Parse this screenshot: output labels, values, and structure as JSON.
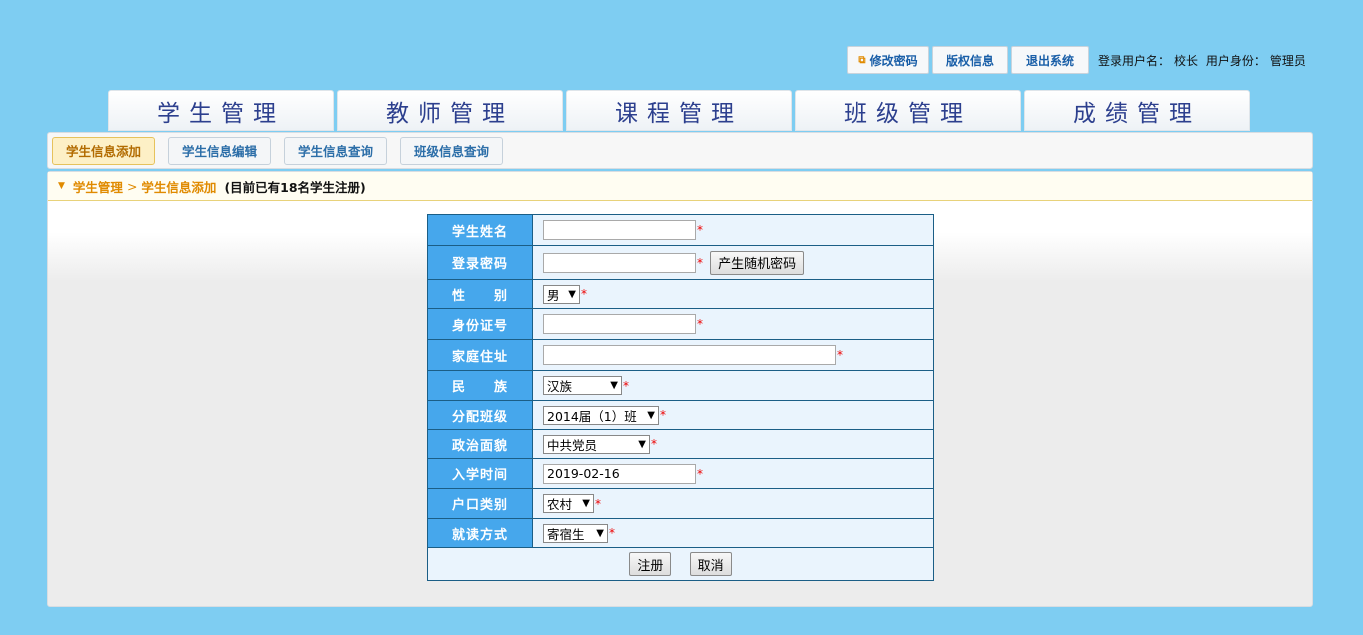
{
  "topbar": {
    "change_password": "修改密码",
    "copyright": "版权信息",
    "logout": "退出系统",
    "username_label": "登录用户名：",
    "username": "校长",
    "role_label": "用户身份：",
    "role": "管理员"
  },
  "nav": {
    "tabs": [
      "学生管理",
      "教师管理",
      "课程管理",
      "班级管理",
      "成绩管理"
    ]
  },
  "subnav": {
    "tabs": [
      "学生信息添加",
      "学生信息编辑",
      "学生信息查询",
      "班级信息查询"
    ],
    "active_index": 0
  },
  "breadcrumb": {
    "section": "学生管理",
    "separator": ">",
    "page": "学生信息添加",
    "note": "(目前已有18名学生注册)"
  },
  "form": {
    "fields": [
      {
        "label": "学生姓名",
        "type": "text",
        "value": "",
        "required": true
      },
      {
        "label": "登录密码",
        "type": "text",
        "value": "",
        "required": true,
        "button": "产生随机密码"
      },
      {
        "label": "性　　别",
        "type": "select",
        "value": "男",
        "required": true
      },
      {
        "label": "身份证号",
        "type": "text",
        "value": "",
        "required": true
      },
      {
        "label": "家庭住址",
        "type": "text",
        "value": "",
        "required": true
      },
      {
        "label": "民　　族",
        "type": "select",
        "value": "汉族",
        "required": true
      },
      {
        "label": "分配班级",
        "type": "select",
        "value": "2014届（1）班",
        "required": true
      },
      {
        "label": "政治面貌",
        "type": "select",
        "value": "中共党员",
        "required": true
      },
      {
        "label": "入学时间",
        "type": "text",
        "value": "2019-02-16",
        "required": true
      },
      {
        "label": "户口类别",
        "type": "select",
        "value": "农村",
        "required": true
      },
      {
        "label": "就读方式",
        "type": "select",
        "value": "寄宿生",
        "required": true
      }
    ],
    "required_mark": "*",
    "submit": "注册",
    "cancel": "取消"
  },
  "colors": {
    "background": "#7ecdf2",
    "label_cell": "#46a7ec",
    "value_cell": "#eaf4fd",
    "accent": "#e08a00",
    "nav_text": "#2c3f8e"
  }
}
